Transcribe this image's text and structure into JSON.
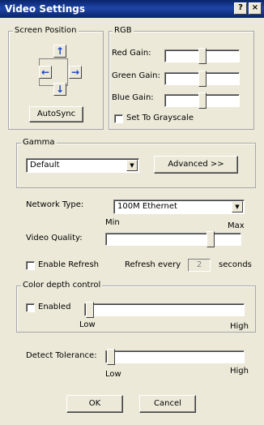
{
  "window": {
    "title": "Video Settings",
    "help_label": "?",
    "close_label": "×"
  },
  "screen_position": {
    "legend": "Screen Position",
    "arrows": {
      "up": "↑",
      "left": "←",
      "right": "→",
      "down": "↓"
    },
    "autosync_label": "AutoSync"
  },
  "rgb": {
    "legend": "RGB",
    "red_label": "Red Gain:",
    "red_value": 0.5,
    "green_label": "Green Gain:",
    "green_value": 0.5,
    "blue_label": "Blue Gain:",
    "blue_value": 0.5,
    "grayscale_label": "Set To Grayscale",
    "grayscale_checked": false
  },
  "gamma": {
    "legend": "Gamma",
    "selected": "Default",
    "advanced_label": "Advanced >>"
  },
  "network": {
    "label": "Network Type:",
    "selected": "100M Ethernet"
  },
  "video_quality": {
    "label": "Video Quality:",
    "min_label": "Min",
    "max_label": "Max",
    "value": 0.8
  },
  "refresh": {
    "enable_label": "Enable Refresh",
    "enabled": false,
    "every_label": "Refresh every",
    "value": "2",
    "unit_label": "seconds"
  },
  "color_depth": {
    "legend": "Color depth control",
    "enabled_label": "Enabled",
    "enabled": false,
    "low_label": "Low",
    "high_label": "High",
    "value": 0.0
  },
  "detect_tolerance": {
    "label": "Detect Tolerance:",
    "low_label": "Low",
    "high_label": "High",
    "value": 0.0
  },
  "buttons": {
    "ok_label": "OK",
    "cancel_label": "Cancel"
  },
  "colors": {
    "title_bar": "#0a246a",
    "window_bg": "#ece9d8",
    "arrow": "#1442c8"
  },
  "icons": {
    "help": "help-icon",
    "close": "close-icon"
  }
}
